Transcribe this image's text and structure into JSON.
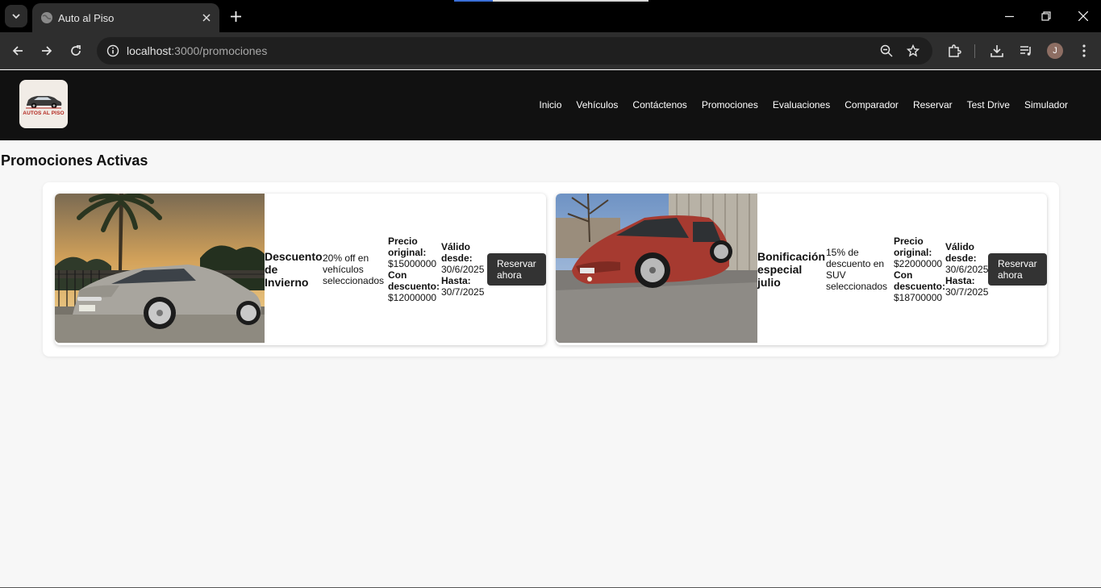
{
  "browser": {
    "tab_title": "Auto al Piso",
    "url_host": "localhost",
    "url_path": ":3000/promociones",
    "profile_initial": "J",
    "icons": [
      "tab-search-icon",
      "globe-icon",
      "close-icon",
      "plus-icon",
      "minimize-icon",
      "restore-icon",
      "close-window-icon",
      "back-arrow-icon",
      "forward-arrow-icon",
      "reload-icon",
      "site-info-icon",
      "zoom-icon",
      "star-icon",
      "extensions-icon",
      "download-icon",
      "media-icon",
      "menu-icon"
    ]
  },
  "site": {
    "logo_text": "AUTOS AL PISO",
    "nav": [
      "Inicio",
      "Vehículos",
      "Contáctenos",
      "Promociones",
      "Evaluaciones",
      "Comparador",
      "Reservar",
      "Test Drive",
      "Simulador"
    ]
  },
  "main": {
    "title": "Promociones Activas",
    "labels": {
      "precio_original": "Precio original:",
      "con_descuento": "Con descuento:",
      "valido_desde": "Válido desde:",
      "hasta": "Hasta:",
      "reservar": "Reservar ahora"
    },
    "promos": [
      {
        "title": "Descuento de Invierno",
        "description": "20% off en vehículos seleccionados",
        "precio_original": "$15000000",
        "con_descuento": "$12000000",
        "desde": "30/6/2025",
        "hasta": "30/7/2025",
        "car_color": "silver"
      },
      {
        "title": "Bonificación especial julio",
        "description": "15% de descuento en SUV seleccionados",
        "precio_original": "$22000000",
        "con_descuento": "$18700000",
        "desde": "30/6/2025",
        "hasta": "30/7/2025",
        "car_color": "red"
      }
    ]
  }
}
